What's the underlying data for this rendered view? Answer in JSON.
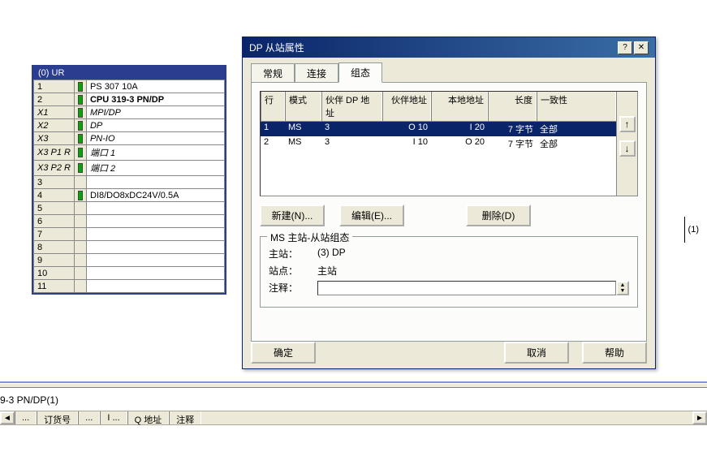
{
  "rack": {
    "title": "(0) UR",
    "rows": [
      {
        "idx": "1",
        "mark": true,
        "name": "PS 307 10A"
      },
      {
        "idx": "2",
        "mark": true,
        "name": "CPU 319-3 PN/DP",
        "bold": true
      },
      {
        "idx": "X1",
        "mark": true,
        "name": "MPI/DP",
        "italic": true
      },
      {
        "idx": "X2",
        "mark": true,
        "name": "DP",
        "italic": true
      },
      {
        "idx": "X3",
        "mark": true,
        "name": "PN-IO",
        "italic": true
      },
      {
        "idx": "X3 P1 R",
        "mark": true,
        "name": "端口 1",
        "italic": true
      },
      {
        "idx": "X3 P2 R",
        "mark": true,
        "name": "端口 2",
        "italic": true
      },
      {
        "idx": "3",
        "mark": false,
        "name": ""
      },
      {
        "idx": "4",
        "mark": true,
        "name": "DI8/DO8xDC24V/0.5A"
      },
      {
        "idx": "5",
        "mark": false,
        "name": ""
      },
      {
        "idx": "6",
        "mark": false,
        "name": ""
      },
      {
        "idx": "7",
        "mark": false,
        "name": ""
      },
      {
        "idx": "8",
        "mark": false,
        "name": ""
      },
      {
        "idx": "9",
        "mark": false,
        "name": ""
      },
      {
        "idx": "10",
        "mark": false,
        "name": ""
      },
      {
        "idx": "11",
        "mark": false,
        "name": ""
      }
    ]
  },
  "dialog": {
    "title": "DP 从站属性",
    "tabs": {
      "general": "常规",
      "connect": "连接",
      "config": "组态"
    },
    "headers": {
      "line": "行",
      "mode": "模式",
      "partner_dp": "伙伴 DP 地址",
      "partner_addr": "伙伴地址",
      "local_addr": "本地地址",
      "length": "长度",
      "consistency": "一致性"
    },
    "rows": [
      {
        "line": "1",
        "mode": "MS",
        "pdp": "3",
        "paddr": "O 10",
        "laddr": "I 20",
        "len": "7 字节",
        "cons": "全部"
      },
      {
        "line": "2",
        "mode": "MS",
        "pdp": "3",
        "paddr": "I 10",
        "laddr": "O 20",
        "len": "7 字节",
        "cons": "全部"
      }
    ],
    "buttons": {
      "new": "新建(N)...",
      "edit": "编辑(E)...",
      "delete": "删除(D)"
    },
    "group": {
      "title": "MS 主站-从站组态",
      "master_label": "主站：",
      "master_val": "(3) DP",
      "station_label": "站点：",
      "station_val": "主站",
      "comment_label": "注释："
    },
    "bottom": {
      "ok": "确定",
      "cancel": "取消",
      "help": "帮助"
    }
  },
  "bottom": {
    "device_label": "9-3 PN/DP(1)",
    "cols": {
      "order": "订货号",
      "i": "I ...",
      "q": "Q 地址",
      "comment": "注释"
    },
    "ellipsis": "..."
  },
  "one_marker": "(1)"
}
